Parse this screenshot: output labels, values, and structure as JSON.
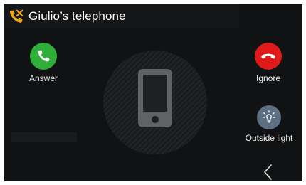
{
  "header": {
    "title": "Giulio’s telephone",
    "icon": "phone-missed-icon"
  },
  "actions": {
    "answer": {
      "label": "Answer",
      "icon": "phone-icon",
      "color": "#2fae3a"
    },
    "ignore": {
      "label": "Ignore",
      "icon": "phone-hangup-icon",
      "color": "#e01a1a"
    },
    "outside_light": {
      "label": "Outside light",
      "icon": "light-bulb-icon",
      "color": "#5c6f83"
    }
  },
  "center": {
    "icon": "smartphone-icon"
  },
  "nav": {
    "back_icon": "chevron-left-icon"
  },
  "colors": {
    "background": "#111213",
    "accent_title_icon": "#f0a81c"
  }
}
